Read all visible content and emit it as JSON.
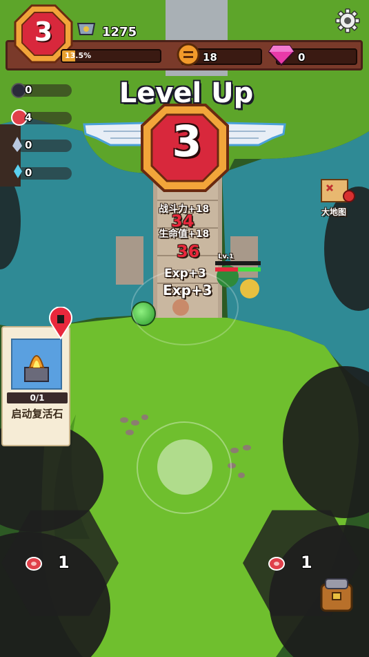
{
  "hud": {
    "player_level": "3",
    "score": "1275",
    "exp_percent": "13.5%",
    "exp_fraction": 0.135,
    "coins": "18",
    "gems": "0"
  },
  "resources": [
    {
      "icon": "dark-orb-icon",
      "value": "0"
    },
    {
      "icon": "meat-icon",
      "value": "4"
    },
    {
      "icon": "feather-icon",
      "value": "0"
    },
    {
      "icon": "crystal-icon",
      "value": "0"
    }
  ],
  "level_up": {
    "title": "Level Up",
    "level": "3"
  },
  "floating": {
    "combat_power": "战斗力+18",
    "damage_1": "34",
    "hp": "生命值+18",
    "damage_2": "36",
    "exp_1": "Exp+3",
    "exp_2": "Exp+3",
    "unit_level": "Lv.1"
  },
  "map_button": {
    "label": "大地图"
  },
  "revive_card": {
    "progress": "0/1",
    "label": "启动复活石"
  },
  "bottom_left_hex": {
    "value": "1"
  },
  "bottom_right_hex": {
    "value": "1"
  },
  "colors": {
    "hud_bar": "#7a3a2a",
    "badge_red": "#d8283c",
    "badge_gold": "#f2a53a",
    "water": "#2f8a95",
    "grass": "#6fbf2e"
  }
}
